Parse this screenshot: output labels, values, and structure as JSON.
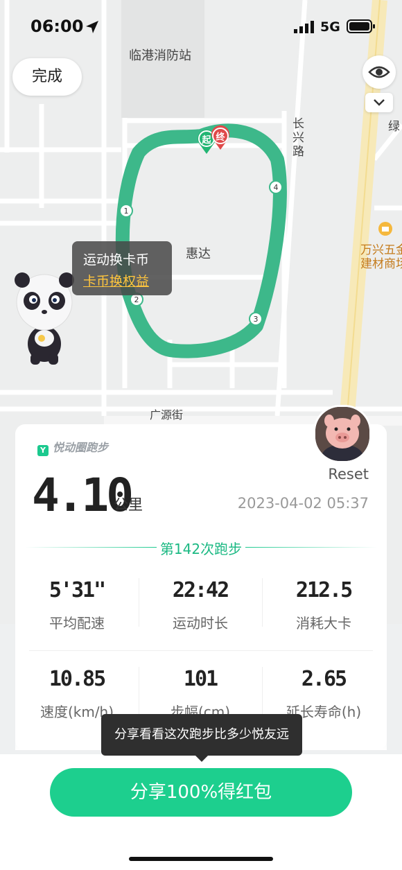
{
  "status_bar": {
    "time": "06:00",
    "network": "5G"
  },
  "map": {
    "labels": {
      "fire_station": "临港消防站",
      "huida": "惠达",
      "guangyuan_st": "广源街",
      "changxing_rd_1": "长",
      "changxing_rd_2": "兴",
      "changxing_rd_3": "路",
      "wanxing_1": "万兴五金",
      "wanxing_2": "建材商场",
      "green_fragment": "绿"
    },
    "route_color": "#3db88a",
    "start_marker": "起",
    "end_marker": "终",
    "km_markers": [
      "1",
      "2",
      "3",
      "4"
    ]
  },
  "done_button": "完成",
  "coin_tooltip": {
    "title": "运动换卡币",
    "link": "卡币换权益"
  },
  "card": {
    "brand": "悦动圈跑步",
    "distance": "4.10",
    "distance_unit": "公里",
    "username": "Reset",
    "datetime": "2023-04-02 05:37",
    "run_count_label": "第142次跑步",
    "stats": [
      {
        "value": "5'31\"",
        "label": "平均配速"
      },
      {
        "value": "22:42",
        "label": "运动时长"
      },
      {
        "value": "212.5",
        "label": "消耗大卡"
      },
      {
        "value": "10.85",
        "label": "速度(km/h)"
      },
      {
        "value": "101",
        "label": "步幅(cm)"
      },
      {
        "value": "2.65",
        "label": "延长寿命(h)"
      }
    ]
  },
  "share_tip": "分享看看这次跑步比多少悦友远",
  "share_button": "分享100%得红包",
  "accent_color": "#1dcf8e"
}
